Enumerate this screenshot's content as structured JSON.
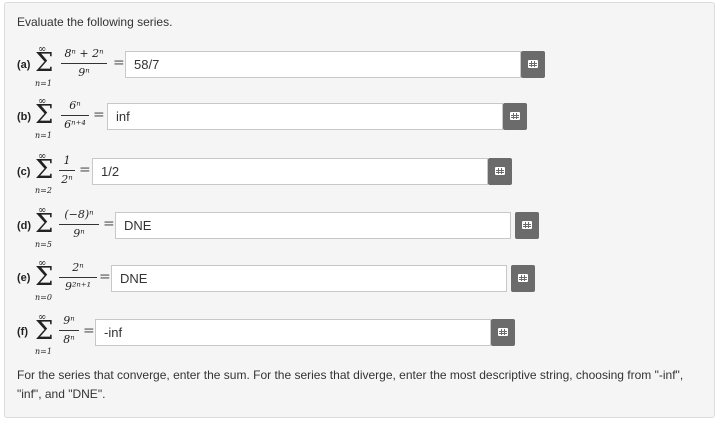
{
  "prompt": "Evaluate the following series.",
  "parts": [
    {
      "label": "(a)",
      "upper": "∞",
      "lower": "n=1",
      "numerator": "8ⁿ + 2ⁿ",
      "denominator": "9ⁿ",
      "answer": "58/7"
    },
    {
      "label": "(b)",
      "upper": "∞",
      "lower": "n=1",
      "numerator": "6ⁿ",
      "denominator": "6ⁿ⁺⁴",
      "answer": "inf"
    },
    {
      "label": "(c)",
      "upper": "∞",
      "lower": "n=2",
      "numerator": "1",
      "denominator": "2ⁿ",
      "answer": "1/2"
    },
    {
      "label": "(d)",
      "upper": "∞",
      "lower": "n=5",
      "numerator": "(−8)ⁿ",
      "denominator": "9ⁿ",
      "answer": "DNE"
    },
    {
      "label": "(e)",
      "upper": "∞",
      "lower": "n=0",
      "numerator": "2ⁿ",
      "denominator": "9²ⁿ⁺¹",
      "answer": "DNE"
    },
    {
      "label": "(f)",
      "upper": "∞",
      "lower": "n=1",
      "numerator": "9ⁿ",
      "denominator": "8ⁿ",
      "answer": "-inf"
    }
  ],
  "equals_sign": "=",
  "sigma": "Σ",
  "instructions": "For the series that converge, enter the sum. For the series that diverge, enter the most descriptive string, choosing from \"-inf\", \"inf\", and \"DNE\".",
  "colors": {
    "panel_bg": "#f5f5f5",
    "button_bg": "#6b6b6b",
    "input_border": "#c8c8c8"
  }
}
